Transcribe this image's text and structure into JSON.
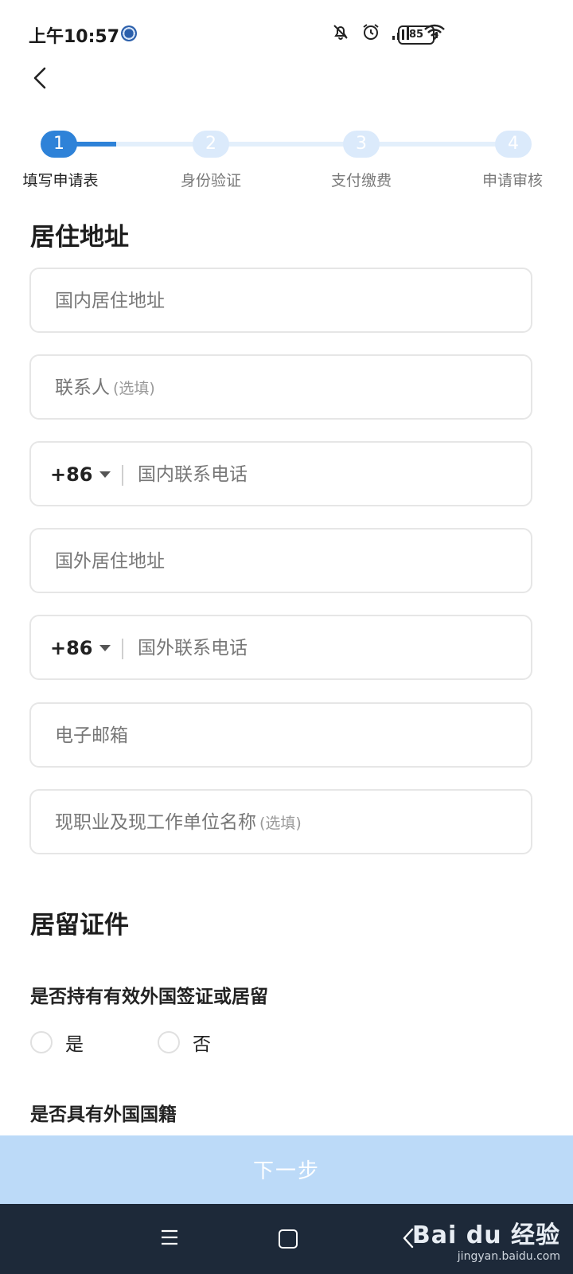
{
  "status_bar": {
    "time": "上午10:57",
    "battery": "85",
    "icons": [
      "mute-icon",
      "alarm-icon",
      "signal-icon",
      "wifi-icon",
      "battery-icon"
    ]
  },
  "stepper": {
    "steps": [
      {
        "number": "1",
        "label": "填写申请表",
        "state": "active"
      },
      {
        "number": "2",
        "label": "身份验证",
        "state": "inactive"
      },
      {
        "number": "3",
        "label": "支付缴费",
        "state": "inactive"
      },
      {
        "number": "4",
        "label": "申请审核",
        "state": "inactive"
      }
    ],
    "accent_color": "#2e82d8"
  },
  "residence": {
    "title": "居住地址",
    "domestic_address": "国内居住地址",
    "contact_person": "联系人",
    "contact_person_optional": "(选填)",
    "domestic_phone_code": "+86",
    "domestic_phone": "国内联系电话",
    "foreign_address": "国外居住地址",
    "foreign_phone_code": "+86",
    "foreign_phone": "国外联系电话",
    "email": "电子邮箱",
    "occupation": "现职业及现工作单位名称",
    "occupation_optional": "(选填)"
  },
  "residence_permit": {
    "title": "居留证件",
    "q1": "是否持有有效外国签证或居留",
    "q1_yes": "是",
    "q1_no": "否",
    "q2": "是否具有外国国籍"
  },
  "next_button": {
    "label": "下一步"
  },
  "watermark": {
    "main": "Bai du 经验",
    "sub": "jingyan.baidu.com"
  }
}
